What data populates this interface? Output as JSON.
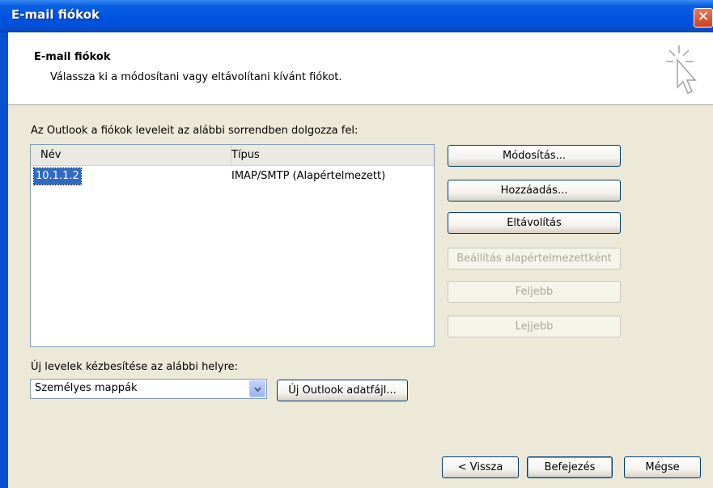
{
  "window": {
    "title": "E-mail fiókok",
    "close_glyph": "✕"
  },
  "header": {
    "title": "E-mail fiókok",
    "subtitle": "Válassza ki a módosítani vagy eltávolítani kívánt fiókot."
  },
  "accounts": {
    "intro": "Az Outlook a fiókok leveleit az alábbi sorrendben dolgozza fel:",
    "columns": {
      "name": "Név",
      "type": "Típus"
    },
    "rows": [
      {
        "name": "10.1.1.2",
        "type": "IMAP/SMTP (Alapértelmezett)"
      }
    ]
  },
  "side_buttons": {
    "modify": "Módosítás...",
    "add": "Hozzáadás...",
    "remove": "Eltávolítás",
    "set_default": "Beállítás alapértelmezettként",
    "move_up": "Feljebb",
    "move_down": "Lejjebb"
  },
  "delivery": {
    "label": "Új levelek kézbesítése az alábbi helyre:",
    "selected": "Személyes mappák",
    "new_datafile": "Új Outlook adatfájl..."
  },
  "footer": {
    "back": "< Vissza",
    "finish": "Befejezés",
    "cancel": "Mégse"
  }
}
